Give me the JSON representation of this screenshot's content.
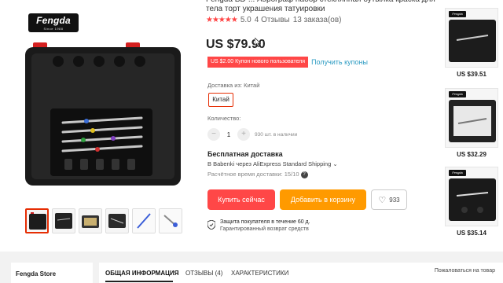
{
  "brand": {
    "name": "Fengda",
    "sub": "Since 1988"
  },
  "product": {
    "title": "Fengda BD-... Аэрограф набор стеклянная бутылка краска для тела торт украшения татуировки",
    "stars": "★★★★★",
    "rating": "5.0",
    "reviews": "4 Отзывы",
    "orders": "13 заказа(ов)",
    "price": "US $79.90"
  },
  "coupon": {
    "badge": "US $2.00 Купон нового пользователя",
    "link": "Получить купоны"
  },
  "ship_from": {
    "label": "Доставка из:",
    "country_label": "Китай",
    "selected": "Китай"
  },
  "quantity": {
    "label": "Количество:",
    "minus": "−",
    "value": "1",
    "plus": "+",
    "available": "930 шт. в наличии"
  },
  "shipping": {
    "title": "Бесплатная доставка",
    "via": "В Babenki через AliExpress Standard Shipping ⌄",
    "time": "Расчётное время доставки: 15/10",
    "help": "?"
  },
  "actions": {
    "buy_now": "Купить сейчас",
    "add_to_cart": "Добавить в корзину",
    "wishlist_count": "933"
  },
  "protection": {
    "line1": "Защита покупателя в течение 60 д.",
    "line2": "Гарантированный возврат средств"
  },
  "side_products": [
    {
      "price": "US $39.51",
      "brand": "Fengda"
    },
    {
      "price": "US $32.29",
      "brand": "Fengda"
    },
    {
      "price": "US $35.14",
      "brand": "Fengda"
    }
  ],
  "store": {
    "name": "Fengda Store"
  },
  "tabs": [
    {
      "label": "ОБЩАЯ ИНФОРМАЦИЯ"
    },
    {
      "label": "ОТЗЫВЫ (4)"
    },
    {
      "label": "ХАРАКТЕРИСТИКИ"
    }
  ],
  "report_link": "Пожаловаться на товар",
  "colors": {
    "accent_red": "#ff4747",
    "accent_orange": "#ff9a00",
    "link_blue": "#2e9cc3",
    "star_red": "#ff4444"
  },
  "icons": [
    "heart-icon",
    "shield-icon",
    "help-icon",
    "mouse-cursor-icon"
  ]
}
